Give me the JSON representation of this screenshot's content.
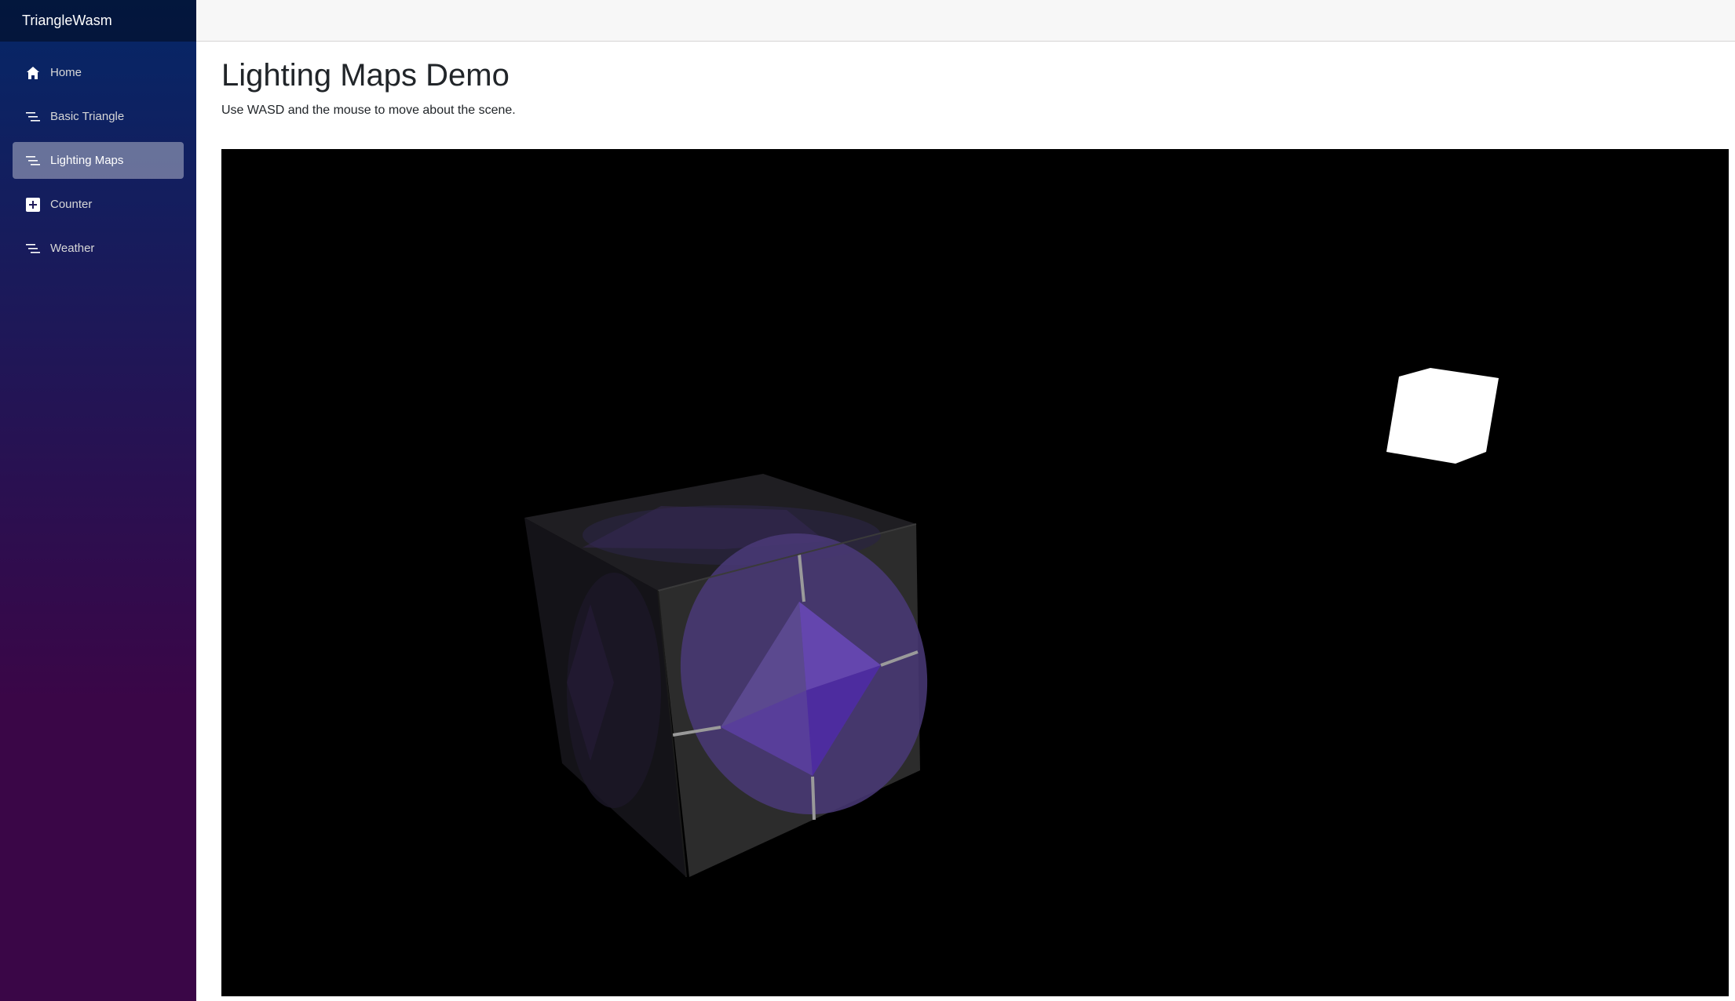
{
  "app": {
    "brand": "TriangleWasm"
  },
  "sidebar": {
    "items": [
      {
        "label": "Home",
        "icon": "home-icon",
        "active": false
      },
      {
        "label": "Basic Triangle",
        "icon": "list-icon",
        "active": false
      },
      {
        "label": "Lighting Maps",
        "icon": "list-icon",
        "active": true
      },
      {
        "label": "Counter",
        "icon": "plus-icon",
        "active": false
      },
      {
        "label": "Weather",
        "icon": "list-icon",
        "active": false
      }
    ]
  },
  "main": {
    "title": "Lighting Maps Demo",
    "subtitle": "Use WASD and the mouse to move about the scene."
  },
  "colors": {
    "sidebar_gradient_start": "#052767",
    "sidebar_gradient_end": "#3a0647",
    "canvas_background": "#000000",
    "cube_face": "#2b2b2b",
    "cube_accent": "#5b3a9e",
    "light_cube": "#ffffff"
  }
}
